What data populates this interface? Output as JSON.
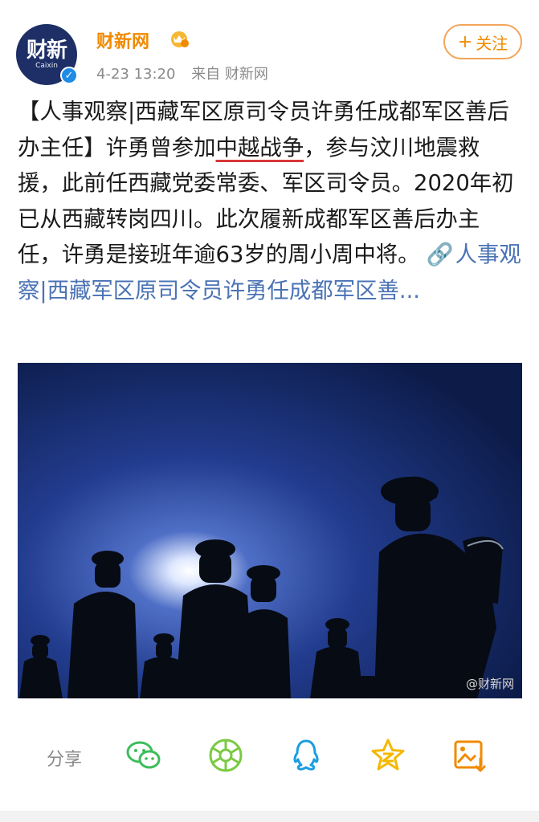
{
  "account": {
    "avatar_text": "财新",
    "avatar_sub": "Caixin",
    "username": "财新网",
    "time": "4-23 13:20",
    "source": "来自 财新网",
    "follow_label": "关注",
    "follow_plus": "+"
  },
  "post": {
    "text_part1": "【人事观察|西藏军区原司令员许勇任成都军区善后办主任】许勇曾参加",
    "text_underlined": "中越战争",
    "text_part2": "，参与汶川地震救援，此前任西藏党委常委、军区司令员。2020年初已从西藏转岗四川。此次履新成都军区善后办主任，许勇是接班年逾63岁的周小周中将。",
    "link_icon": "🔗",
    "link_text": "人事观察|西藏军区原司令员许勇任成都军区善..."
  },
  "image": {
    "watermark": "@财新网"
  },
  "actions": {
    "share_label": "分享",
    "icons": [
      "wechat-icon",
      "moments-icon",
      "qq-icon",
      "qzone-icon",
      "save-image-icon"
    ]
  },
  "colors": {
    "accent_orange": "#f08a00",
    "link_blue": "#4a73b5",
    "wechat_green": "#3dbd5b",
    "qq_blue": "#1b9de2",
    "qzone_yellow": "#f5b800"
  }
}
